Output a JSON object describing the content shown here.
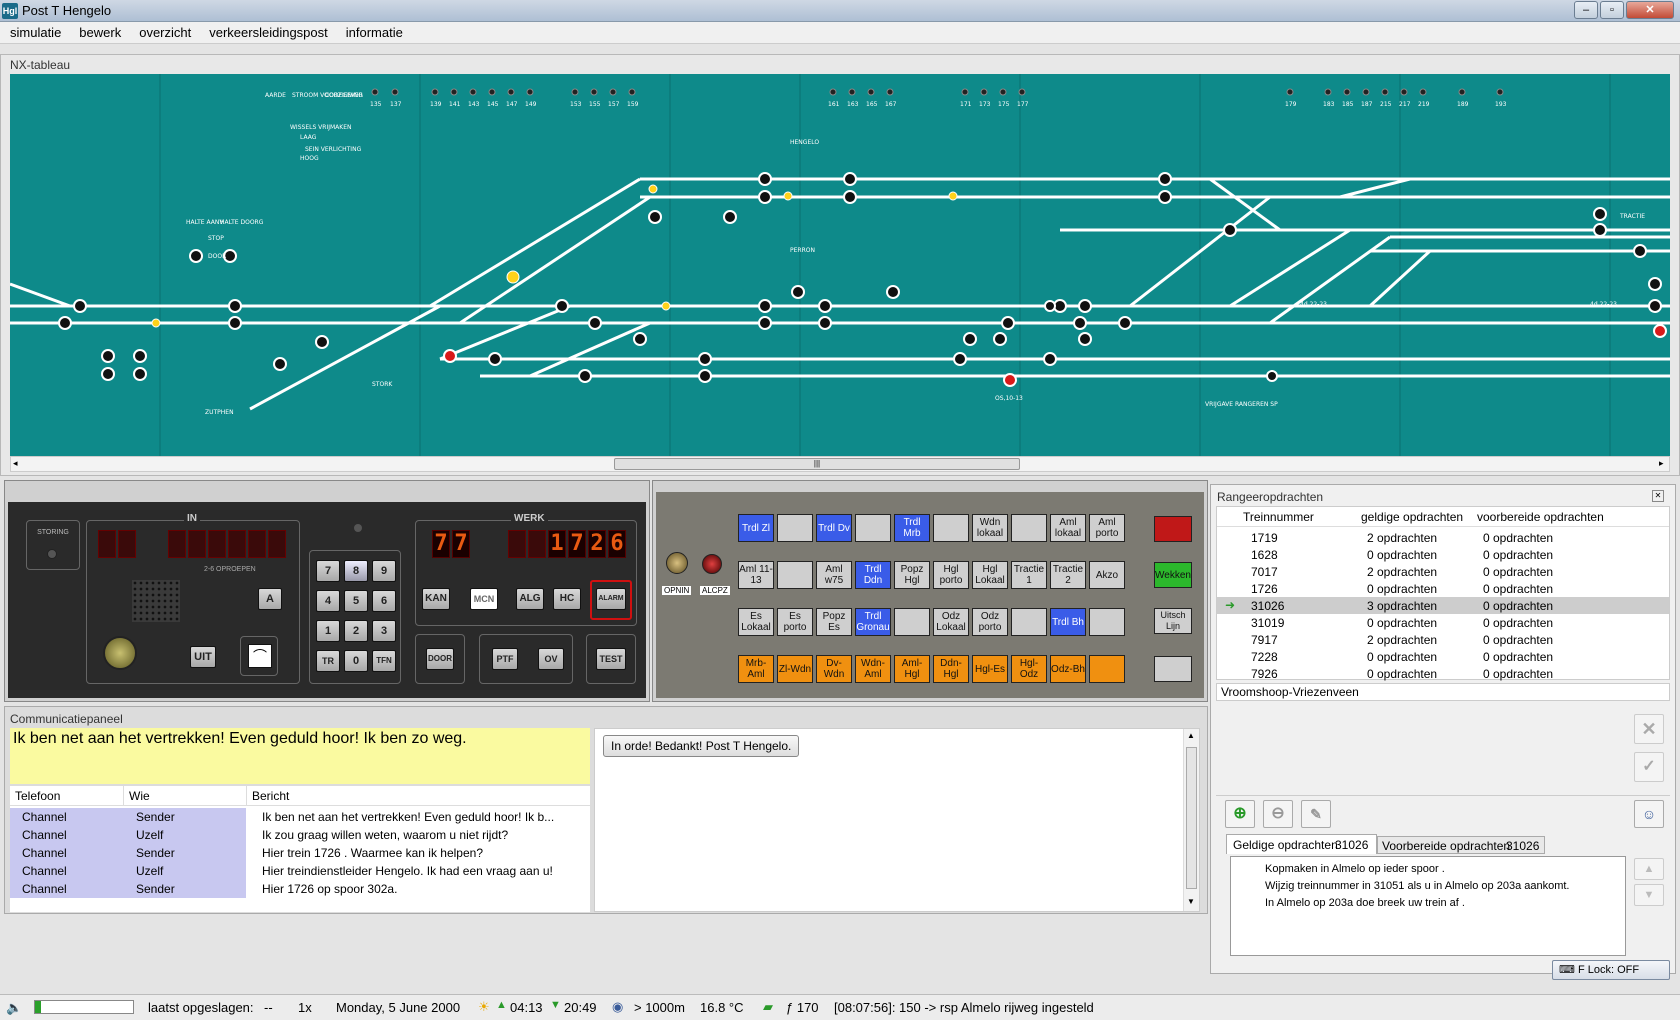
{
  "window": {
    "title": "Post T Hengelo",
    "app_icon": "Hgl"
  },
  "menu": [
    "simulatie",
    "bewerk",
    "overzicht",
    "verkeersleidingspost",
    "informatie"
  ],
  "nx": {
    "title": "NX-tableau",
    "scroll_grip": "|||",
    "labels": {
      "hengelo": "HENGELO",
      "perron": "PERRON",
      "zutphen": "ZUTPHEN",
      "stork": "STORK",
      "halte_aanv": "HALTE AANV",
      "halte_doorg": "HALTE DOORG",
      "stop": "STOP",
      "door": "DOOR",
      "vrijgave": "VRIJGAVE RANGEREN SP",
      "sp_a": "4d 22-23",
      "sp_b": "4d,22-23",
      "ohc": "OS,10-13",
      "trdl1": "TRACTIE",
      "aardd": "AARDE",
      "stroom": "STROOM VOORZIENING",
      "codegever": "CODEGEVER",
      "wissels": "WISSELS VRIJMAKEN",
      "laag": "LAAG",
      "hoog": "HOOG",
      "verl": "SEIN VERLICHTING"
    },
    "top_signals": [
      "135",
      "137",
      "139",
      "141",
      "143",
      "145",
      "147",
      "149",
      "153",
      "155",
      "157",
      "159",
      "161",
      "163",
      "165",
      "167",
      "171",
      "173",
      "175",
      "177",
      "179",
      "183",
      "185",
      "187",
      "215",
      "217",
      "219",
      "189",
      "193"
    ]
  },
  "control": {
    "storing": "STORING",
    "in_label": "IN",
    "oproepen": "2-6 OPROEPEN",
    "werk_label": "WERK",
    "werk_left": [
      "7",
      "7"
    ],
    "werk_right": [
      "1",
      "7",
      "2",
      "6"
    ],
    "keypad": [
      "7",
      "8",
      "9",
      "4",
      "5",
      "6",
      "1",
      "2",
      "3",
      "TR",
      "0",
      "TFN"
    ],
    "btn_a": "A",
    "btn_uit": "UIT",
    "btn_kan": "KAN",
    "btn_mcn": "MCN",
    "btn_alg": "ALG",
    "btn_hc": "HC",
    "btn_alarm": "ALARM",
    "btn_door": "DOOR",
    "btn_ptf": "PTF",
    "btn_ov": "OV",
    "btn_test": "TEST"
  },
  "tracks": {
    "opnin": "OPNIN",
    "alcpz": "ALCPZ",
    "rows": [
      [
        {
          "t": "Trdl Zl",
          "c": "blue"
        },
        {
          "t": "",
          "c": "grey"
        },
        {
          "t": "Trdl Dv",
          "c": "blue"
        },
        {
          "t": "",
          "c": "grey"
        },
        {
          "t": "Trdl Mrb",
          "c": "blue"
        },
        {
          "t": "",
          "c": "grey"
        },
        {
          "t": "Wdn lokaal",
          "c": "grey"
        },
        {
          "t": "",
          "c": "grey"
        },
        {
          "t": "Aml lokaal",
          "c": "grey"
        },
        {
          "t": "Aml porto",
          "c": "grey"
        }
      ],
      [
        {
          "t": "Aml 11-13",
          "c": "grey"
        },
        {
          "t": "",
          "c": "grey"
        },
        {
          "t": "Aml w75",
          "c": "grey"
        },
        {
          "t": "Trdl Ddn",
          "c": "blue"
        },
        {
          "t": "Popz Hgl",
          "c": "grey"
        },
        {
          "t": "Hgl porto",
          "c": "grey"
        },
        {
          "t": "Hgl Lokaal",
          "c": "grey"
        },
        {
          "t": "Tractie 1",
          "c": "grey"
        },
        {
          "t": "Tractie 2",
          "c": "grey"
        },
        {
          "t": "Akzo",
          "c": "grey"
        }
      ],
      [
        {
          "t": "Es Lokaal",
          "c": "grey"
        },
        {
          "t": "Es porto",
          "c": "grey"
        },
        {
          "t": "Popz Es",
          "c": "grey"
        },
        {
          "t": "Trdl Gronau",
          "c": "blue"
        },
        {
          "t": "",
          "c": "grey"
        },
        {
          "t": "Odz Lokaal",
          "c": "grey"
        },
        {
          "t": "Odz porto",
          "c": "grey"
        },
        {
          "t": "",
          "c": "grey"
        },
        {
          "t": "Trdl Bh",
          "c": "blue"
        },
        {
          "t": "",
          "c": "grey"
        }
      ],
      [
        {
          "t": "Mrb-Aml",
          "c": "org"
        },
        {
          "t": "Zl-Wdn",
          "c": "org"
        },
        {
          "t": "Dv-Wdn",
          "c": "org"
        },
        {
          "t": "Wdn-Aml",
          "c": "org"
        },
        {
          "t": "Aml-Hgl",
          "c": "org"
        },
        {
          "t": "Ddn-Hgl",
          "c": "org"
        },
        {
          "t": "Hgl-Es",
          "c": "org"
        },
        {
          "t": "Hgl-Odz",
          "c": "org"
        },
        {
          "t": "Odz-Bh",
          "c": "org"
        },
        {
          "t": "",
          "c": "org"
        }
      ]
    ],
    "wekken": "Wekken",
    "uitsch": "Uitsch Lijn"
  },
  "rangeer": {
    "title": "Rangeeropdrachten",
    "cols": [
      "Treinnummer",
      "geldige opdrachten",
      "voorbereide opdrachten"
    ],
    "rows": [
      [
        "1719",
        "2 opdrachten",
        "0 opdrachten"
      ],
      [
        "1628",
        "0 opdrachten",
        "0 opdrachten"
      ],
      [
        "7017",
        "2 opdrachten",
        "0 opdrachten"
      ],
      [
        "1726",
        "0 opdrachten",
        "0 opdrachten"
      ],
      [
        "31026",
        "3 opdrachten",
        "0 opdrachten"
      ],
      [
        "31019",
        "0 opdrachten",
        "0 opdrachten"
      ],
      [
        "7917",
        "2 opdrachten",
        "0 opdrachten"
      ],
      [
        "7228",
        "0 opdrachten",
        "0 opdrachten"
      ],
      [
        "7926",
        "0 opdrachten",
        "0 opdrachten"
      ]
    ],
    "selected": 4,
    "location": "Vroomshoop-Vriezenveen",
    "tab1": "Geldige opdrachten",
    "tab1_num": "31026",
    "tab2": "Voorbereide opdrachten",
    "tab2_num": "31026",
    "orders": [
      "Kopmaken in Almelo op ieder spoor .",
      "Wijzig treinnummer in 31051 als u in Almelo op 203a aankomt.",
      "In Almelo op 203a doe breek uw trein af ."
    ]
  },
  "comm": {
    "title": "Communicatiepaneel",
    "message": "Ik ben net aan het vertrekken! Even geduld hoor! Ik ben zo weg.",
    "reply": "In orde! Bedankt! Post T Hengelo.",
    "cols": [
      "Telefoon",
      "Wie",
      "Bericht"
    ],
    "rows": [
      [
        "Channel",
        "Sender",
        "Ik ben net aan het vertrekken! Even geduld hoor! Ik b..."
      ],
      [
        "Channel",
        "Uzelf",
        "Ik zou graag willen weten, waarom u niet rijdt?"
      ],
      [
        "Channel",
        "Sender",
        "Hier trein 1726 . Waarmee kan ik helpen?"
      ],
      [
        "Channel",
        "Uzelf",
        "Hier treindienstleider Hengelo. Ik had een vraag aan u!"
      ],
      [
        "Channel",
        "Sender",
        "Hier 1726 op spoor 302a."
      ]
    ]
  },
  "status": {
    "saved_label": "laatst opgeslagen:",
    "saved": "--",
    "speed": "1x",
    "date": "Monday, 5 June 2000",
    "sunrise": "04:13",
    "sunset": "20:49",
    "visibility": "> 1000m",
    "temp": "16.8 °C",
    "money": "ƒ 170",
    "log": "[08:07:56]: 150 -> rsp Almelo rijweg ingesteld",
    "flock": "F Lock: OFF"
  }
}
